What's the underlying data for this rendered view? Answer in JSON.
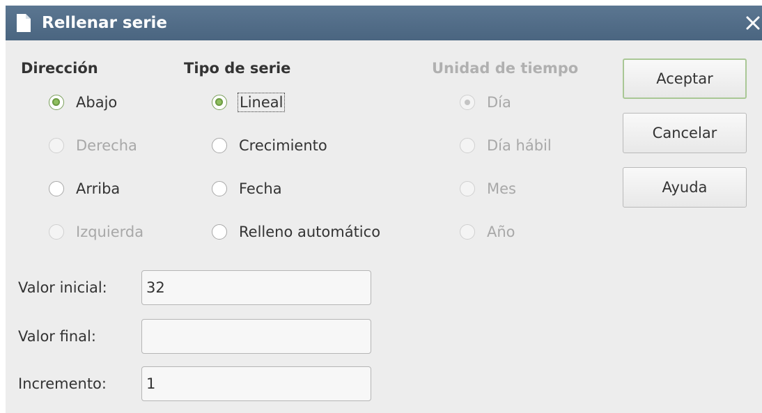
{
  "window": {
    "title": "Rellenar serie",
    "close_symbol": "✕"
  },
  "direccion": {
    "heading": "Dirección",
    "options": [
      {
        "label": "Abajo",
        "checked": true,
        "enabled": true
      },
      {
        "label": "Derecha",
        "checked": false,
        "enabled": false
      },
      {
        "label": "Arriba",
        "checked": false,
        "enabled": true
      },
      {
        "label": "Izquierda",
        "checked": false,
        "enabled": false
      }
    ]
  },
  "tipo_serie": {
    "heading": "Tipo de serie",
    "options": [
      {
        "label": "Lineal",
        "checked": true,
        "enabled": true,
        "focused": true
      },
      {
        "label": "Crecimiento",
        "checked": false,
        "enabled": true
      },
      {
        "label": "Fecha",
        "checked": false,
        "enabled": true
      },
      {
        "label": "Relleno automático",
        "checked": false,
        "enabled": true
      }
    ]
  },
  "unidad_tiempo": {
    "heading": "Unidad de tiempo",
    "enabled": false,
    "options": [
      {
        "label": "Día",
        "checked": true,
        "enabled": false
      },
      {
        "label": "Día hábil",
        "checked": false,
        "enabled": false
      },
      {
        "label": "Mes",
        "checked": false,
        "enabled": false
      },
      {
        "label": "Año",
        "checked": false,
        "enabled": false
      }
    ]
  },
  "buttons": {
    "ok": "Aceptar",
    "cancel": "Cancelar",
    "help": "Ayuda"
  },
  "fields": {
    "start_label": "Valor inicial:",
    "start_value": "32",
    "end_label": "Valor final:",
    "end_value": "",
    "increment_label": "Incremento:",
    "increment_value": "1"
  },
  "icons": {
    "title": "document-icon",
    "close": "close-icon"
  },
  "colors": {
    "titlebar": "#4f6a85",
    "radio_checked": "#8fbf5f",
    "default_button_border": "#a9c795"
  }
}
